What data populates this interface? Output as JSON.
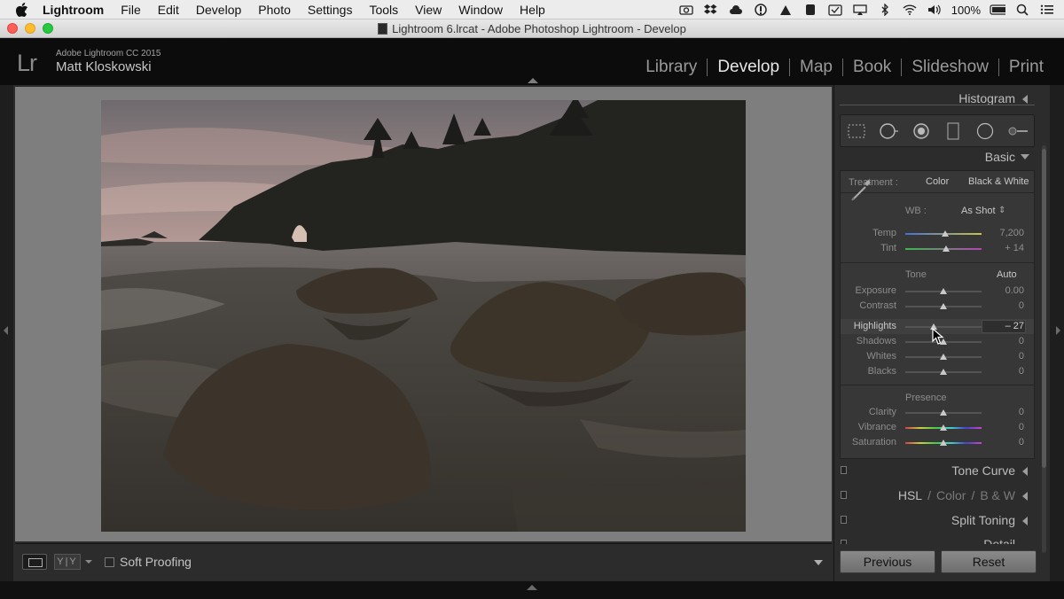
{
  "menubar": {
    "app_name": "Lightroom",
    "items": [
      "File",
      "Edit",
      "Develop",
      "Photo",
      "Settings",
      "Tools",
      "View",
      "Window",
      "Help"
    ],
    "battery": "100%"
  },
  "window": {
    "title": "Lightroom 6.lrcat - Adobe Photoshop Lightroom - Develop"
  },
  "identity": {
    "logo": "Lr",
    "line1": "Adobe Lightroom CC 2015",
    "line2": "Matt Kloskowski"
  },
  "modules": [
    "Library",
    "Develop",
    "Map",
    "Book",
    "Slideshow",
    "Print"
  ],
  "active_module": "Develop",
  "toolbar": {
    "soft_proofing": "Soft Proofing",
    "view_modes_label": "Y|Y"
  },
  "panels": {
    "histogram": "Histogram",
    "basic": "Basic",
    "tone_curve": "Tone Curve",
    "hsl": "HSL",
    "color": "Color",
    "bw": "B & W",
    "split_toning": "Split Toning",
    "detail": "Detail"
  },
  "basic": {
    "treatment_label": "Treatment :",
    "treatment_color": "Color",
    "treatment_bw": "Black & White",
    "wb_label": "WB :",
    "wb_value": "As Shot",
    "tone_label": "Tone",
    "auto_label": "Auto",
    "presence_label": "Presence",
    "sliders": {
      "temp": {
        "label": "Temp",
        "value": "7,200",
        "pos": 0.52
      },
      "tint": {
        "label": "Tint",
        "value": "+ 14",
        "pos": 0.54
      },
      "exposure": {
        "label": "Exposure",
        "value": "0.00",
        "pos": 0.5
      },
      "contrast": {
        "label": "Contrast",
        "value": "0",
        "pos": 0.5
      },
      "highlights": {
        "label": "Highlights",
        "value": "– 27",
        "pos": 0.37
      },
      "shadows": {
        "label": "Shadows",
        "value": "0",
        "pos": 0.5
      },
      "whites": {
        "label": "Whites",
        "value": "0",
        "pos": 0.5
      },
      "blacks": {
        "label": "Blacks",
        "value": "0",
        "pos": 0.5
      },
      "clarity": {
        "label": "Clarity",
        "value": "0",
        "pos": 0.5
      },
      "vibrance": {
        "label": "Vibrance",
        "value": "0",
        "pos": 0.5
      },
      "saturation": {
        "label": "Saturation",
        "value": "0",
        "pos": 0.5
      }
    }
  },
  "buttons": {
    "previous": "Previous",
    "reset": "Reset"
  },
  "colors": {
    "panel_bg": "#2c2c2c",
    "canvas_bg": "#7e7e7e",
    "active_module": "#e6e6e6"
  }
}
